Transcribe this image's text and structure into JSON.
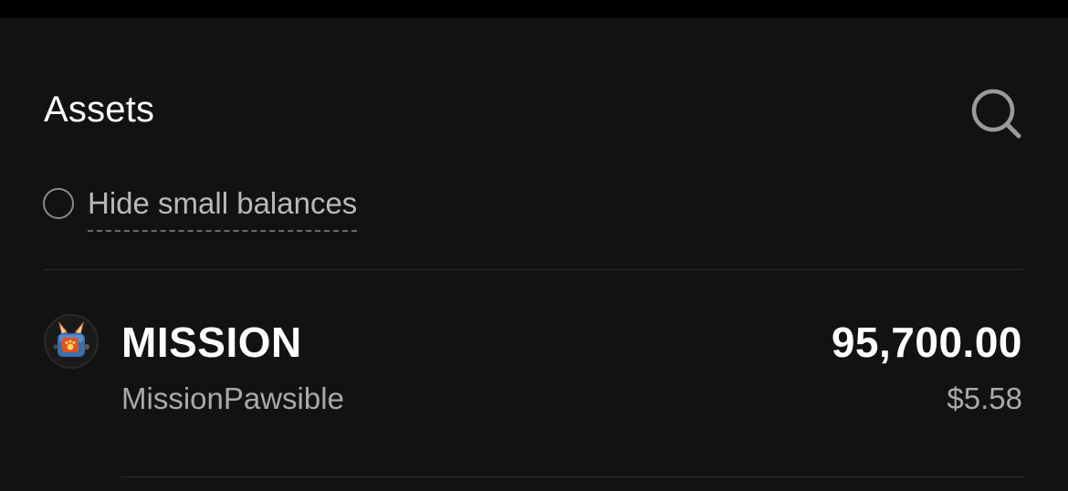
{
  "header": {
    "title": "Assets",
    "search_icon": "search-icon"
  },
  "filter": {
    "hide_small_balances_label": "Hide small balances",
    "hide_small_balances_checked": false
  },
  "assets": [
    {
      "icon": "mission-pawsible-token-icon",
      "symbol": "MISSION",
      "name": "MissionPawsible",
      "amount": "95,700.00",
      "value": "$5.58"
    }
  ],
  "colors": {
    "background": "#121212",
    "top_bar": "#000000",
    "primary_text": "#ffffff",
    "secondary_text": "#a9a9a9",
    "divider": "#2c2c2c"
  }
}
